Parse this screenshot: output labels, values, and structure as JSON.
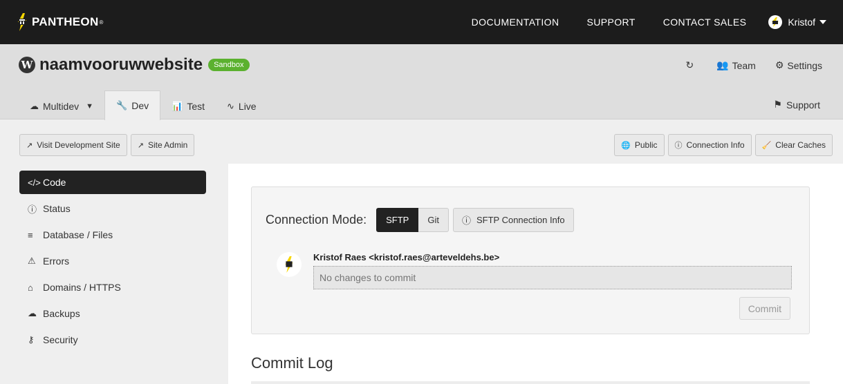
{
  "topbar": {
    "brand": "PANTHEON",
    "brand_mark": "®",
    "nav": [
      "DOCUMENTATION",
      "SUPPORT",
      "CONTACT SALES"
    ],
    "user_name": "Kristof"
  },
  "site": {
    "name": "naamvooruwwebsite",
    "badge": "Sandbox",
    "actions": {
      "team": "Team",
      "settings": "Settings"
    }
  },
  "env_tabs": {
    "multidev": "Multidev",
    "dev": "Dev",
    "test": "Test",
    "live": "Live",
    "support": "Support"
  },
  "actions": {
    "visit_dev": "Visit Development Site",
    "site_admin": "Site Admin",
    "public": "Public",
    "connection_info": "Connection Info",
    "clear_caches": "Clear Caches"
  },
  "sidebar": {
    "items": [
      {
        "label": "Code",
        "icon": "code-icon"
      },
      {
        "label": "Status",
        "icon": "info-icon"
      },
      {
        "label": "Database / Files",
        "icon": "database-icon"
      },
      {
        "label": "Errors",
        "icon": "warning-icon"
      },
      {
        "label": "Domains / HTTPS",
        "icon": "home-icon"
      },
      {
        "label": "Backups",
        "icon": "cloud-upload-icon"
      },
      {
        "label": "Security",
        "icon": "keys-icon"
      }
    ]
  },
  "code": {
    "connection_mode_label": "Connection Mode:",
    "mode_sftp": "SFTP",
    "mode_git": "Git",
    "sftp_info": "SFTP Connection Info",
    "author": "Kristof Raes <kristof.raes@arteveldehs.be>",
    "commit_placeholder": "No changes to commit",
    "commit_button": "Commit",
    "log_title": "Commit Log"
  },
  "colors": {
    "topbar": "#1c1c1c",
    "header": "#dedede",
    "sandbox_badge": "#5bb12f",
    "active": "#222222",
    "brand_yellow": "#f7d600"
  }
}
